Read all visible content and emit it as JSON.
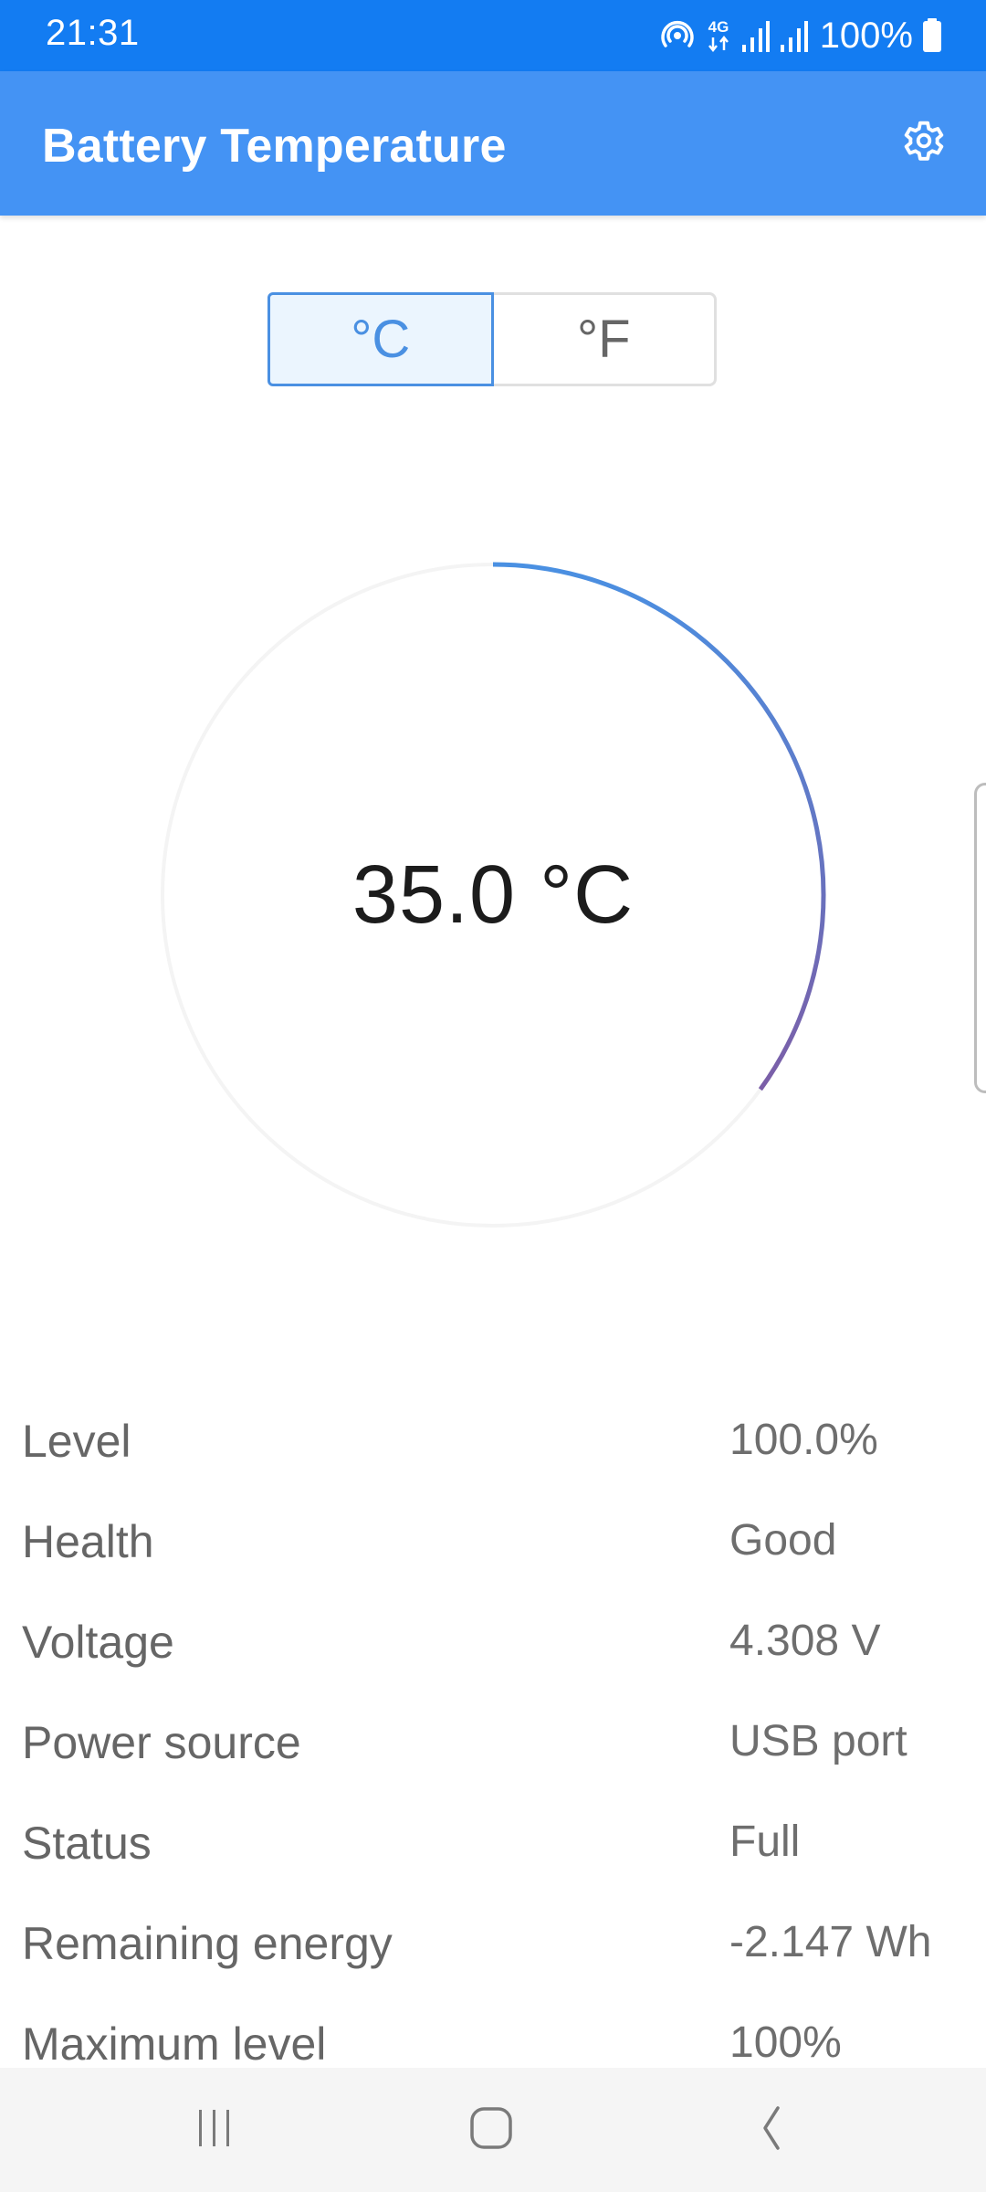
{
  "status_bar": {
    "time": "21:31",
    "icons": [
      "hotspot-icon",
      "4g-data-icon",
      "signal-sim1-icon",
      "signal-sim2-icon"
    ],
    "battery_percent": "100%",
    "battery_icon": "battery-full-icon"
  },
  "app_bar": {
    "title": "Battery Temperature",
    "settings_icon": "gear-icon",
    "color": "#4493f4"
  },
  "unit_toggle": {
    "options": [
      {
        "label": "°C",
        "selected": true
      },
      {
        "label": "°F",
        "selected": false
      }
    ]
  },
  "gauge": {
    "value_text": "35.0 °C",
    "value": 35.0,
    "max": 100,
    "fraction": 0.35,
    "gradient_start_color": "#4a90e2",
    "gradient_end_color": "#7b5ea7",
    "track_color": "#f4f4f4"
  },
  "info": [
    {
      "label": "Level",
      "value": "100.0%"
    },
    {
      "label": "Health",
      "value": "Good"
    },
    {
      "label": "Voltage",
      "value": "4.308 V"
    },
    {
      "label": "Power source",
      "value": "USB port"
    },
    {
      "label": "Status",
      "value": "Full"
    },
    {
      "label": "Remaining energy",
      "value": "-2.147 Wh"
    },
    {
      "label": "Maximum level",
      "value": "100%"
    }
  ],
  "nav_bar": {
    "buttons": [
      "recent-apps-icon",
      "home-icon",
      "back-icon"
    ]
  }
}
